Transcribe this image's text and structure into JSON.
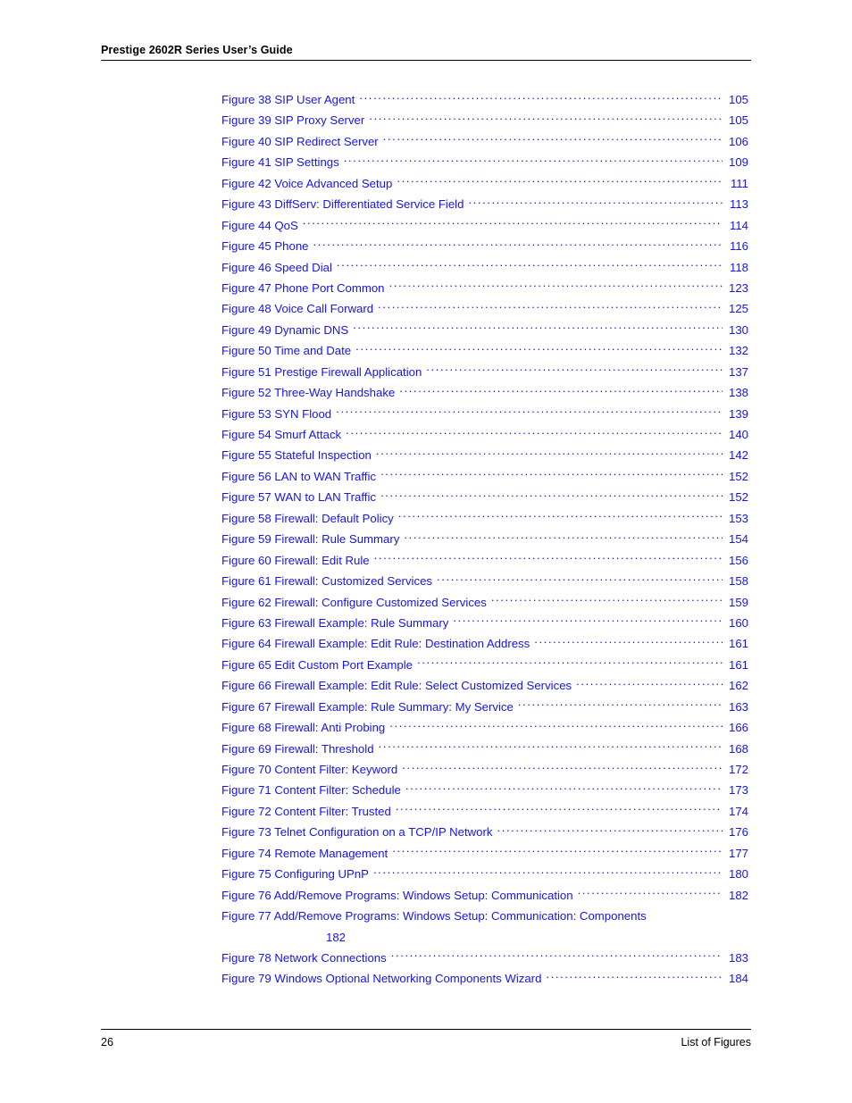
{
  "header": {
    "title": "Prestige 2602R Series User’s Guide"
  },
  "footer": {
    "page_number": "26",
    "section": "List of Figures"
  },
  "accent_color": "#1414f0",
  "list_of_figures": {
    "entries": [
      {
        "title": "Figure 38 SIP User Agent",
        "page": "105"
      },
      {
        "title": "Figure 39 SIP Proxy Server",
        "page": "105"
      },
      {
        "title": "Figure 40 SIP Redirect Server",
        "page": "106"
      },
      {
        "title": "Figure 41 SIP Settings",
        "page": "109"
      },
      {
        "title": "Figure 42 Voice Advanced Setup",
        "page": "111"
      },
      {
        "title": "Figure 43 DiffServ: Differentiated Service Field",
        "page": "113"
      },
      {
        "title": "Figure 44 QoS",
        "page": "114"
      },
      {
        "title": "Figure 45 Phone",
        "page": "116"
      },
      {
        "title": "Figure 46 Speed Dial",
        "page": "118"
      },
      {
        "title": "Figure 47 Phone Port Common",
        "page": "123"
      },
      {
        "title": "Figure 48 Voice Call Forward",
        "page": "125"
      },
      {
        "title": "Figure 49 Dynamic DNS",
        "page": "130"
      },
      {
        "title": "Figure 50 Time and Date",
        "page": "132"
      },
      {
        "title": "Figure 51 Prestige Firewall Application",
        "page": "137"
      },
      {
        "title": "Figure 52 Three-Way Handshake",
        "page": "138"
      },
      {
        "title": "Figure 53 SYN Flood",
        "page": "139"
      },
      {
        "title": "Figure 54 Smurf Attack",
        "page": "140"
      },
      {
        "title": "Figure 55 Stateful Inspection",
        "page": "142"
      },
      {
        "title": "Figure 56 LAN to WAN Traffic",
        "page": "152"
      },
      {
        "title": "Figure 57 WAN to LAN Traffic",
        "page": "152"
      },
      {
        "title": "Figure 58 Firewall: Default Policy",
        "page": "153"
      },
      {
        "title": "Figure 59 Firewall: Rule Summary",
        "page": "154"
      },
      {
        "title": "Figure 60 Firewall: Edit Rule",
        "page": "156"
      },
      {
        "title": "Figure 61 Firewall: Customized Services",
        "page": "158"
      },
      {
        "title": "Figure 62 Firewall: Configure Customized Services",
        "page": "159"
      },
      {
        "title": "Figure 63 Firewall Example: Rule Summary",
        "page": "160"
      },
      {
        "title": "Figure 64 Firewall Example: Edit Rule: Destination Address",
        "page": "161"
      },
      {
        "title": "Figure 65 Edit Custom Port Example",
        "page": "161"
      },
      {
        "title": "Figure 66 Firewall Example: Edit Rule: Select Customized Services",
        "page": "162"
      },
      {
        "title": "Figure 67 Firewall Example: Rule Summary: My Service",
        "page": "163"
      },
      {
        "title": "Figure 68 Firewall: Anti Probing",
        "page": "166"
      },
      {
        "title": "Figure 69 Firewall: Threshold",
        "page": "168"
      },
      {
        "title": "Figure 70 Content Filter: Keyword",
        "page": "172"
      },
      {
        "title": "Figure 71 Content Filter: Schedule",
        "page": "173"
      },
      {
        "title": "Figure 72 Content Filter: Trusted",
        "page": "174"
      },
      {
        "title": "Figure 73 Telnet Configuration on a TCP/IP Network",
        "page": "176"
      },
      {
        "title": "Figure 74 Remote Management",
        "page": "177"
      },
      {
        "title": "Figure 75 Configuring UPnP",
        "page": "180"
      },
      {
        "title": "Figure 76 Add/Remove Programs: Windows Setup: Communication",
        "page": "182"
      },
      {
        "title": "Figure 77 Add/Remove Programs: Windows Setup: Communication: Components",
        "page": "182",
        "wrapped": true
      },
      {
        "title": "Figure 78 Network Connections",
        "page": "183"
      },
      {
        "title": "Figure 79 Windows Optional Networking Components Wizard",
        "page": "184"
      }
    ]
  }
}
